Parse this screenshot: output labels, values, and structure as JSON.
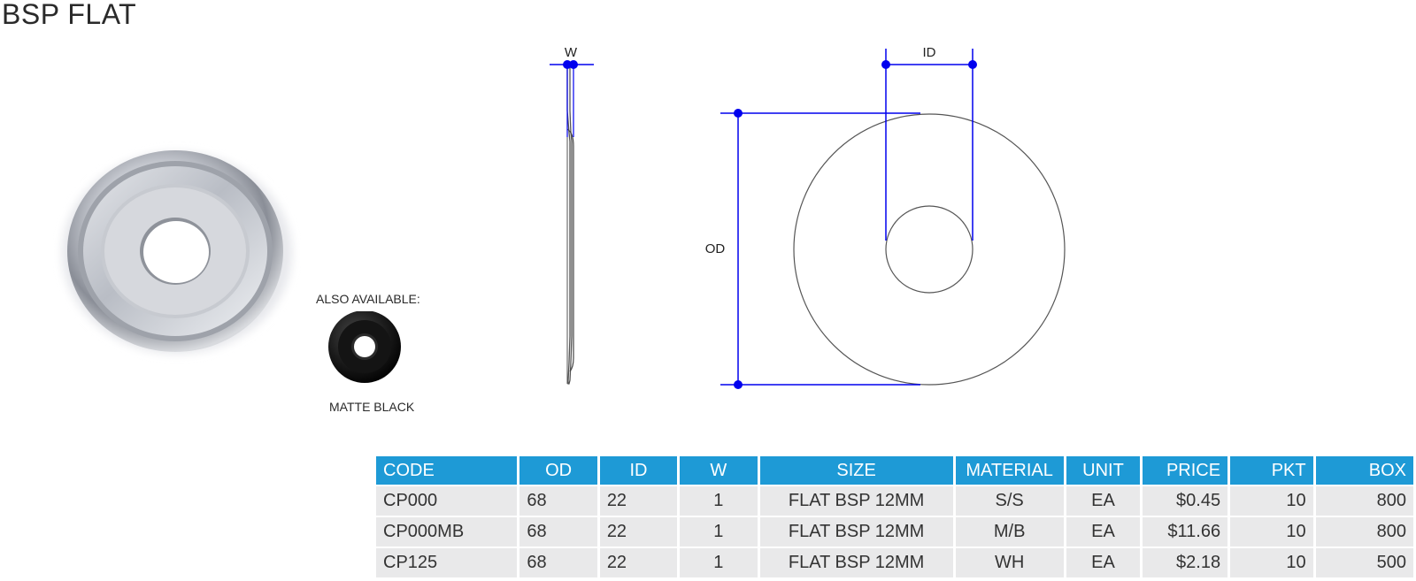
{
  "page": {
    "title": "BSP FLAT"
  },
  "product": {
    "photo_icon": "chrome-flange-plate-image",
    "also_available_label": "ALSO AVAILABLE:",
    "variant_icon": "matte-black-flange-plate-image",
    "variant_label": "MATTE BLACK"
  },
  "diagram": {
    "side_view_label": "W",
    "id_label": "ID",
    "od_label": "OD",
    "dimension_color": "#0000ee"
  },
  "table": {
    "header_color": "#1e9ad6",
    "columns": [
      "CODE",
      "OD",
      "ID",
      "W",
      "SIZE",
      "MATERIAL",
      "UNIT",
      "PRICE",
      "PKT",
      "BOX"
    ],
    "rows": [
      [
        "CP000",
        "68",
        "22",
        "1",
        "FLAT BSP 12MM",
        "S/S",
        "EA",
        "$0.45",
        "10",
        "800"
      ],
      [
        "CP000MB",
        "68",
        "22",
        "1",
        "FLAT BSP 12MM",
        "M/B",
        "EA",
        "$11.66",
        "10",
        "800"
      ],
      [
        "CP125",
        "68",
        "22",
        "1",
        "FLAT BSP 12MM",
        "WH",
        "EA",
        "$2.18",
        "10",
        "500"
      ]
    ]
  }
}
